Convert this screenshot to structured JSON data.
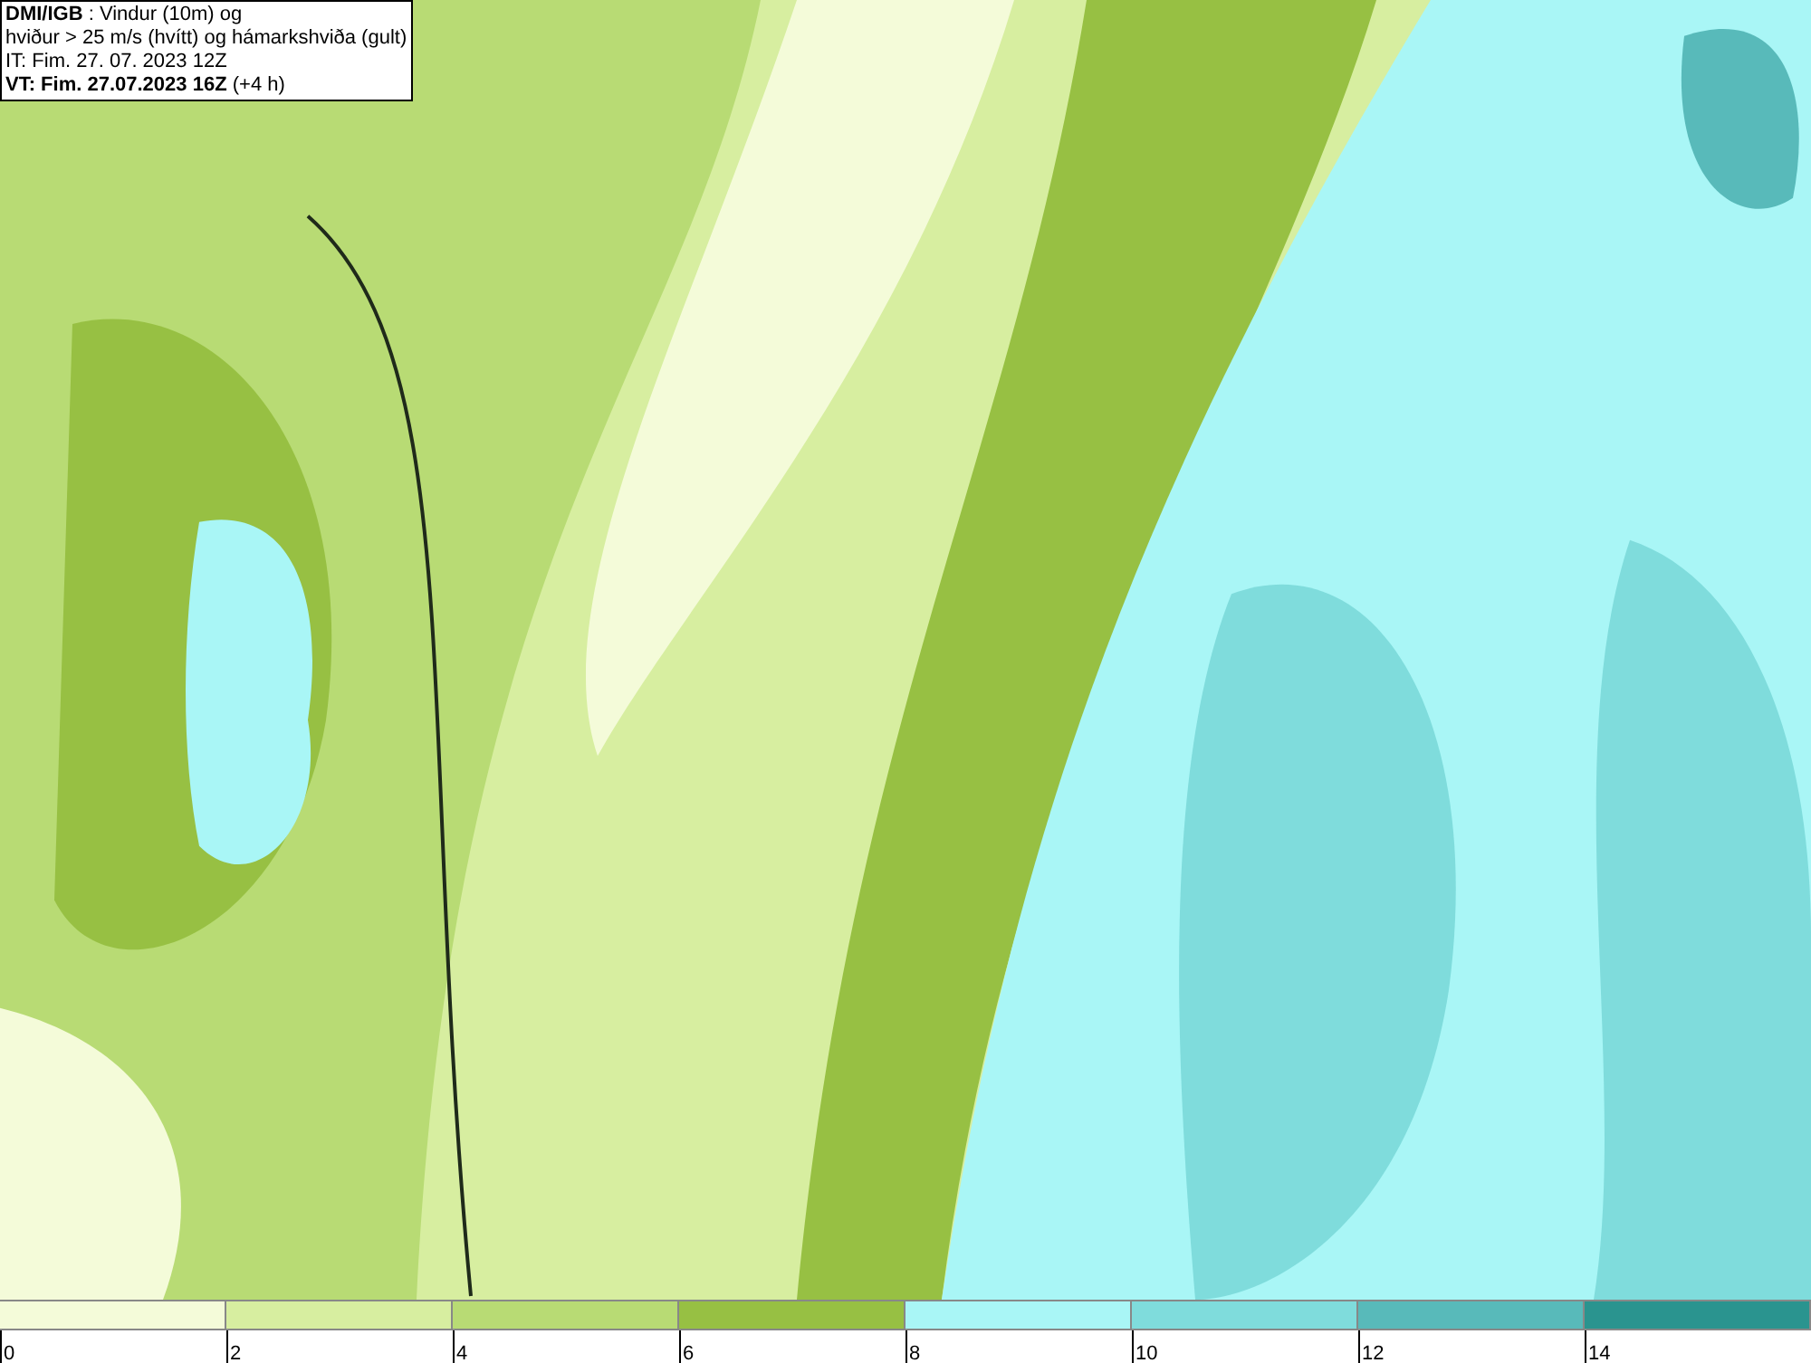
{
  "header": {
    "lines": [
      "**DMI/IGB** : Vindur (10m) og",
      "hviður > 25 m/s (hvítt) og hámarkshviða (gult)",
      "IT: Fim. 27. 07. 2023 12Z",
      "**VT: Fim. 27.07.2023 16Z** (+4 h)"
    ]
  },
  "legend": {
    "swatches": [
      {
        "color": "#f4fbd9"
      },
      {
        "color": "#d7eea0"
      },
      {
        "color": "#b8db74"
      },
      {
        "color": "#97c043"
      },
      {
        "color": "#a9f6f6"
      },
      {
        "color": "#7fdcdc"
      },
      {
        "color": "#58baba"
      },
      {
        "color": "#2a948f"
      }
    ],
    "labels": [
      "0",
      "2",
      "4",
      "6",
      "8",
      "10",
      "12",
      "14"
    ]
  }
}
